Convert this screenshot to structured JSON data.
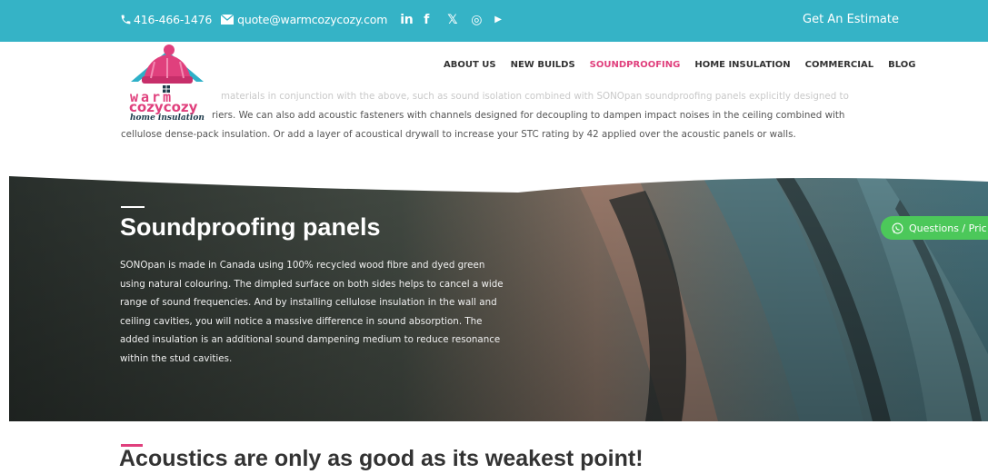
{
  "topbar": {
    "phone": "416-466-1476",
    "email": "quote@warmcozycozy.com",
    "social": [
      {
        "icon": "linkedin-icon",
        "glyph": "in"
      },
      {
        "icon": "facebook-icon",
        "glyph": "f"
      },
      {
        "icon": "x-twitter-icon",
        "glyph": "𝕏"
      },
      {
        "icon": "instagram-icon",
        "glyph": "◎"
      },
      {
        "icon": "youtube-icon",
        "glyph": "▶"
      }
    ],
    "cta": "Get An Estimate",
    "color": "#35b3c6"
  },
  "logo": {
    "line1": "warm",
    "line2": "cozycozy",
    "line3": "home insulation"
  },
  "nav": {
    "items": [
      {
        "label": "ABOUT US",
        "active": false
      },
      {
        "label": "NEW BUILDS",
        "active": false
      },
      {
        "label": "SOUNDPROOFING",
        "active": true
      },
      {
        "label": "HOME INSULATION",
        "active": false
      },
      {
        "label": "COMMERCIAL",
        "active": false
      },
      {
        "label": "BLOG",
        "active": false
      }
    ],
    "active_color": "#e0407d"
  },
  "intro": {
    "line1": "materials in conjunction with the above, such as sound isolation combined with SONOpan soundproofing panels explicitly designed to",
    "line2": "riers. We can also add acoustic fasteners with channels designed  for decoupling to dampen impact noises in the ceiling combined with",
    "line3": "cellulose dense-pack insulation. Or add a layer of acoustical drywall to increase your STC rating by 42 applied over the acoustic panels or walls."
  },
  "hero": {
    "title": "Soundproofing panels",
    "body": "SONOpan is made in Canada using 100% recycled wood fibre and dyed green using natural colouring. The dimpled surface on both sides helps to cancel a wide range of sound frequencies. And by installing cellulose insulation in the wall and ceiling cavities, you will notice a massive difference in sound absorption. The added insulation is an additional sound dampening medium to reduce resonance within the stud cavities."
  },
  "chat": {
    "label": "Questions / Pric",
    "color": "#4cc85a"
  },
  "section": {
    "title": "Acoustics are only as good as its weakest point!"
  }
}
